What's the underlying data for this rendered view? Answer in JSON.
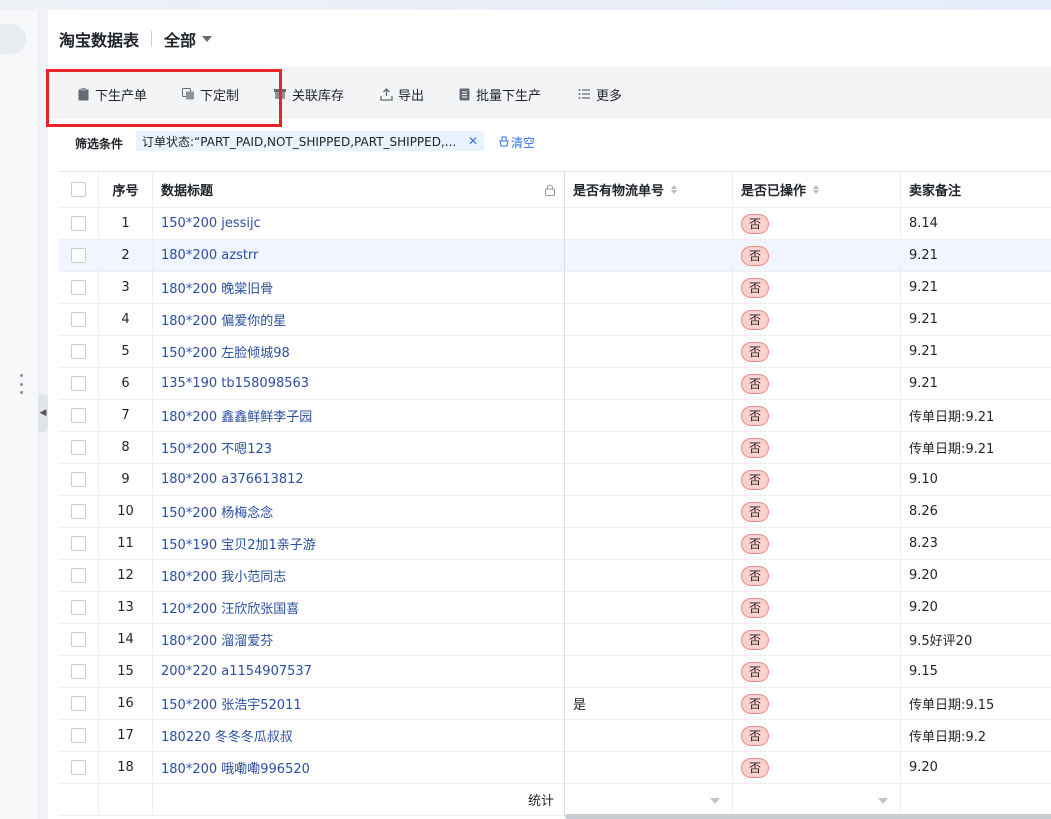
{
  "header": {
    "title": "淘宝数据表",
    "view": "全部"
  },
  "toolbar": {
    "items": [
      {
        "label": "下生产单",
        "icon": "clipboard-icon"
      },
      {
        "label": "下定制",
        "icon": "copy-icon"
      },
      {
        "label": "关联库存",
        "icon": "box-icon"
      },
      {
        "label": "导出",
        "icon": "export-icon"
      },
      {
        "label": "批量下生产",
        "icon": "document-icon"
      },
      {
        "label": "更多",
        "icon": "list-icon"
      }
    ]
  },
  "filter": {
    "label": "筛选条件",
    "chip": "订单状态:“PART_PAID,NOT_SHIPPED,PART_SHIPPED,...",
    "clear": "清空"
  },
  "columns": {
    "no": "序号",
    "title": "数据标题",
    "logistics": "是否有物流单号",
    "operated": "是否已操作",
    "note": "卖家备注"
  },
  "rows": [
    {
      "no": "1",
      "title": "150*200 jessijc",
      "logistics": "",
      "operated": "否",
      "note": "8.14"
    },
    {
      "no": "2",
      "title": "180*200 azstrr",
      "logistics": "",
      "operated": "否",
      "note": "9.21"
    },
    {
      "no": "3",
      "title": "180*200 晚棠旧骨",
      "logistics": "",
      "operated": "否",
      "note": "9.21"
    },
    {
      "no": "4",
      "title": "180*200 偏爱你的星",
      "logistics": "",
      "operated": "否",
      "note": "9.21"
    },
    {
      "no": "5",
      "title": "150*200 左脸倾城98",
      "logistics": "",
      "operated": "否",
      "note": "9.21"
    },
    {
      "no": "6",
      "title": "135*190 tb158098563",
      "logistics": "",
      "operated": "否",
      "note": "9.21"
    },
    {
      "no": "7",
      "title": "180*200 鑫鑫鲜鲜李子园",
      "logistics": "",
      "operated": "否",
      "note": "传单日期:9.21"
    },
    {
      "no": "8",
      "title": "150*200 不嗯123",
      "logistics": "",
      "operated": "否",
      "note": "传单日期:9.21"
    },
    {
      "no": "9",
      "title": "180*200 a376613812",
      "logistics": "",
      "operated": "否",
      "note": "9.10"
    },
    {
      "no": "10",
      "title": "150*200 杨梅念念",
      "logistics": "",
      "operated": "否",
      "note": "8.26"
    },
    {
      "no": "11",
      "title": "150*190 宝贝2加1亲子游",
      "logistics": "",
      "operated": "否",
      "note": "8.23"
    },
    {
      "no": "12",
      "title": "180*200 我小范同志",
      "logistics": "",
      "operated": "否",
      "note": "9.20"
    },
    {
      "no": "13",
      "title": "120*200 汪欣欣张国喜",
      "logistics": "",
      "operated": "否",
      "note": "9.20"
    },
    {
      "no": "14",
      "title": "180*200 溜溜爱芬",
      "logistics": "",
      "operated": "否",
      "note": "9.5好评20"
    },
    {
      "no": "15",
      "title": "200*220 a1154907537",
      "logistics": "",
      "operated": "否",
      "note": "9.15"
    },
    {
      "no": "16",
      "title": "150*200 张浩宇52011",
      "logistics": "是",
      "operated": "否",
      "note": "传单日期:9.15"
    },
    {
      "no": "17",
      "title": "180220 冬冬冬瓜叔叔",
      "logistics": "",
      "operated": "否",
      "note": "传单日期:9.2"
    },
    {
      "no": "18",
      "title": "180*200 哦嘞嘞996520",
      "logistics": "",
      "operated": "否",
      "note": "9.20"
    }
  ],
  "footer": {
    "stats_label": "统计"
  }
}
